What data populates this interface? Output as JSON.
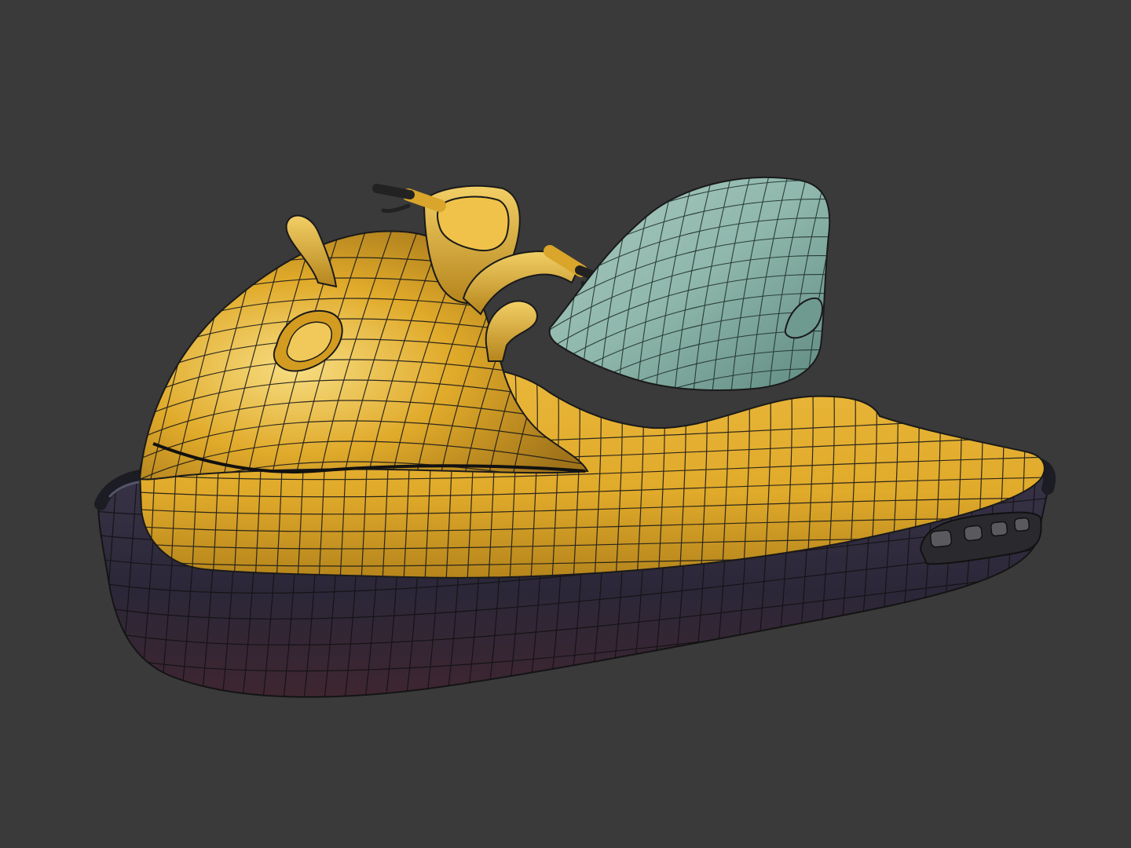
{
  "scene": {
    "subject": "jet-ski-wireframe-model",
    "colors": {
      "background": "#3a3a3a",
      "body_yellow": "#e0aa2a",
      "body_yellow_light": "#f2cf66",
      "body_yellow_dark": "#9a6d12",
      "hull_dark": "#2b2738",
      "hull_mid": "#3a3448",
      "hull_red": "#3e2630",
      "seat_teal": "#8fb7ac",
      "seat_teal_light": "#b3d0c8",
      "seat_teal_dark": "#5f8a80",
      "wire": "#1a1a1a",
      "rubber": "#202020"
    }
  }
}
